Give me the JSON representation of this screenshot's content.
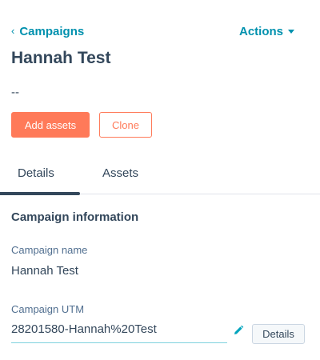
{
  "header": {
    "back_label": "Campaigns",
    "back_icon": "chevron-left-icon",
    "actions_label": "Actions",
    "actions_icon": "caret-down-icon"
  },
  "campaign": {
    "title": "Hannah Test",
    "description": "--"
  },
  "buttons": {
    "add_assets": "Add assets",
    "clone": "Clone"
  },
  "tabs": [
    {
      "label": "Details",
      "active": true
    },
    {
      "label": "Assets",
      "active": false
    }
  ],
  "info": {
    "section_title": "Campaign information",
    "name_label": "Campaign name",
    "name_value": "Hannah Test",
    "utm_label": "Campaign UTM",
    "utm_value": "28201580-Hannah%20Test",
    "edit_icon": "pencil-icon",
    "details_button": "Details"
  },
  "colors": {
    "link": "#0091ae",
    "primary": "#ff7a59",
    "text": "#33475b",
    "muted": "#516f90"
  }
}
